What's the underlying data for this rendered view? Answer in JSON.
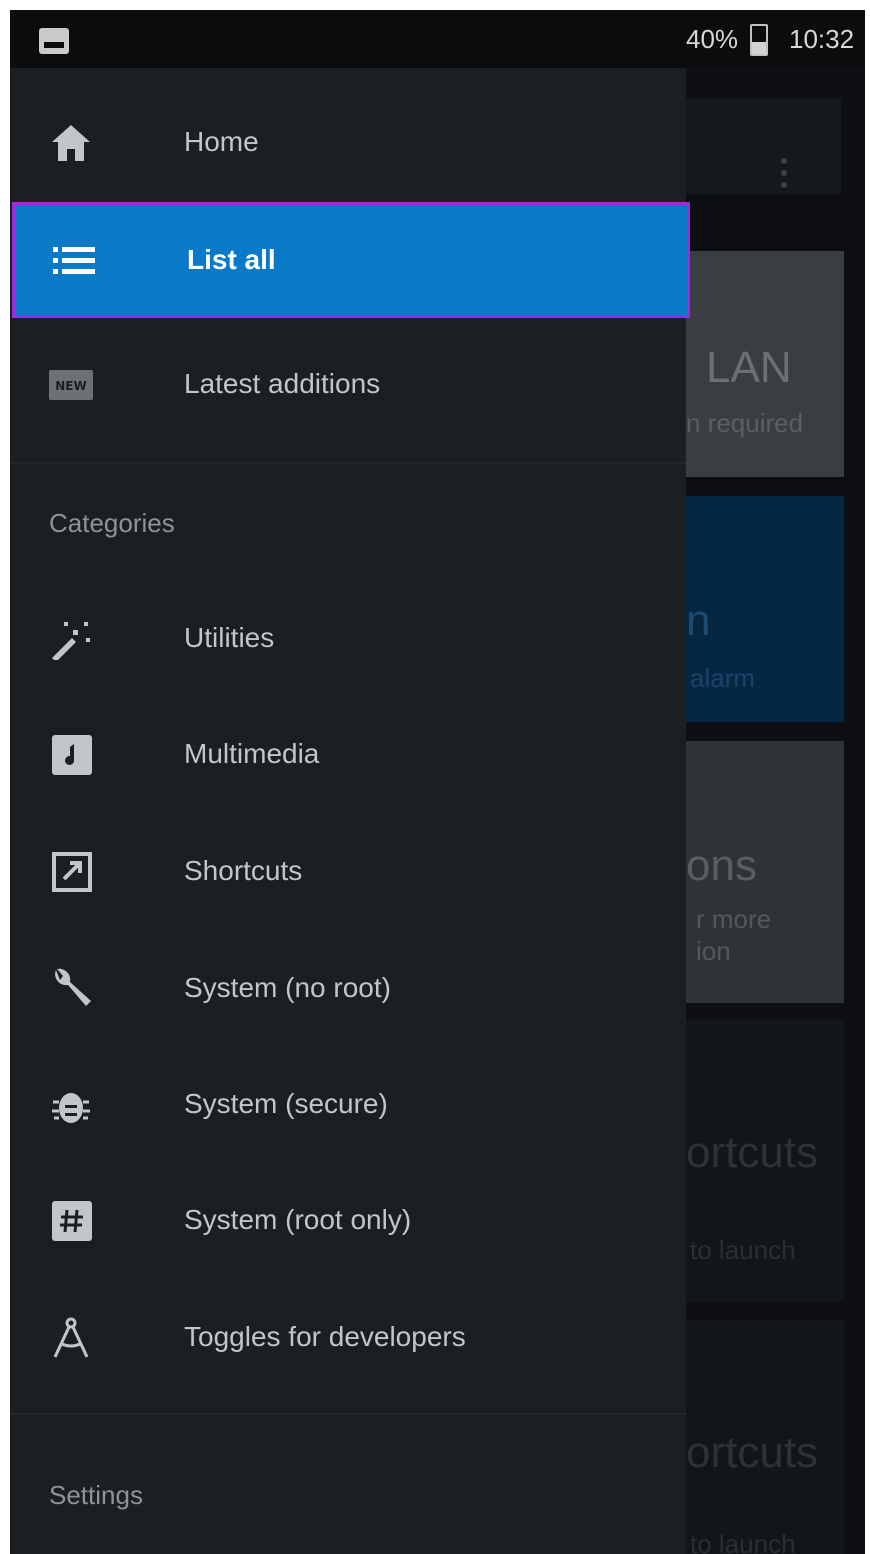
{
  "status_bar": {
    "battery_percent": "40%",
    "time": "10:32",
    "icons": [
      "image-notification-icon",
      "battery-icon"
    ]
  },
  "background_screen": {
    "cards": [
      {
        "title": "LAN",
        "subtitle": "n required"
      },
      {
        "title": "n",
        "subtitle": "alarm"
      },
      {
        "title": "ons",
        "subtitle": "r more\nion"
      },
      {
        "title": "ortcuts",
        "subtitle": "to launch"
      },
      {
        "title": "ortcuts",
        "subtitle": "to launch"
      }
    ]
  },
  "drawer": {
    "top_items": [
      {
        "label": "Home",
        "icon": "home-icon"
      },
      {
        "label": "List all",
        "icon": "list-icon",
        "selected": true
      },
      {
        "label": "Latest additions",
        "icon": "new-badge-icon"
      }
    ],
    "categories_title": "Categories",
    "categories": [
      {
        "label": "Utilities",
        "icon": "magic-wand-icon"
      },
      {
        "label": "Multimedia",
        "icon": "music-note-icon"
      },
      {
        "label": "Shortcuts",
        "icon": "external-link-icon"
      },
      {
        "label": "System (no root)",
        "icon": "wrench-icon"
      },
      {
        "label": "System (secure)",
        "icon": "bug-icon"
      },
      {
        "label": "System (root only)",
        "icon": "hash-icon"
      },
      {
        "label": "Toggles for developers",
        "icon": "compass-icon"
      }
    ],
    "settings_title": "Settings"
  },
  "colors": {
    "drawer_bg": "#1b1e22",
    "selected_bg": "#0a79c7",
    "selection_outline": "#9b2be0"
  }
}
